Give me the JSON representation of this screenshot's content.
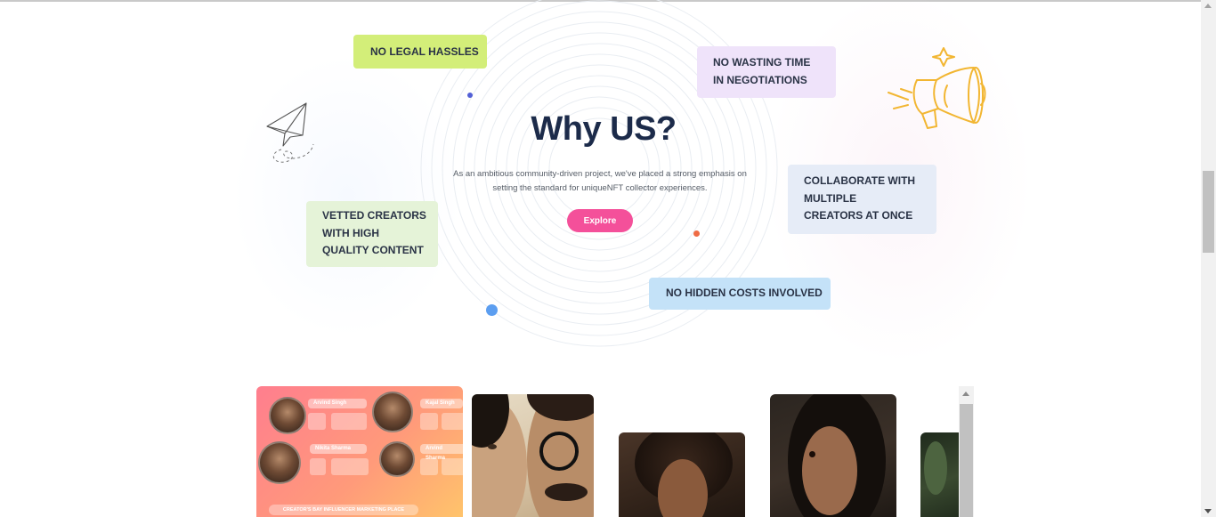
{
  "why": {
    "title": "Why US?",
    "subtitle": "As an ambitious community-driven project, we've placed a strong emphasis on setting the standard for uniqueNFT collector experiences.",
    "cta": "Explore"
  },
  "features": [
    {
      "lines": [
        "NO LEGAL HASSLES"
      ],
      "color": "#d3ee79"
    },
    {
      "lines": [
        "NO WASTING TIME",
        "IN NEGOTIATIONS"
      ],
      "color": "#efe3fa"
    },
    {
      "lines": [
        "COLLABORATE WITH",
        "MULTIPLE",
        "CREATORS AT ONCE"
      ],
      "color": "#e6ecf7"
    },
    {
      "lines": [
        "VETTED CREATORS",
        "WITH HIGH",
        "QUALITY CONTENT"
      ],
      "color": "#e5f3d8"
    },
    {
      "lines": [
        "NO HIDDEN COSTS INVOLVED"
      ],
      "color": "#c4e2f8"
    }
  ],
  "gallery": {
    "marketplace": {
      "names": [
        "Arvind Singh",
        "Kajal Singh",
        "Nikita Sharma",
        "Arvind Sharma"
      ],
      "banner": "CREATOR'S BAY INFLUENCER MARKETING PLACE"
    }
  },
  "icons": {
    "plane": "paper-plane-icon",
    "megaphone": "megaphone-icon"
  },
  "colors": {
    "accent": "#f4509a",
    "heading": "#1c2b4a"
  }
}
